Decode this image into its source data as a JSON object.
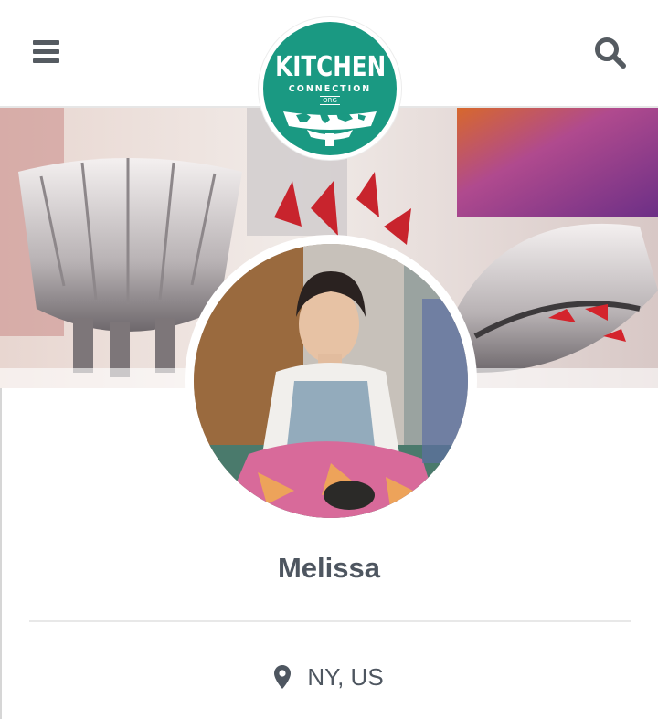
{
  "header": {
    "menu_icon": "hamburger-menu-icon",
    "search_icon": "search-icon",
    "logo": {
      "line1": "KITCHEN",
      "line2": "CONNECTION",
      "line3": "ORG",
      "background_color": "#1a9982"
    }
  },
  "profile": {
    "name": "Melissa",
    "location": "NY, US",
    "location_icon": "map-marker-icon"
  },
  "colors": {
    "text": "#4e5660",
    "icon": "#555b61",
    "divider": "#e8e8e8",
    "brand": "#1a9982"
  }
}
